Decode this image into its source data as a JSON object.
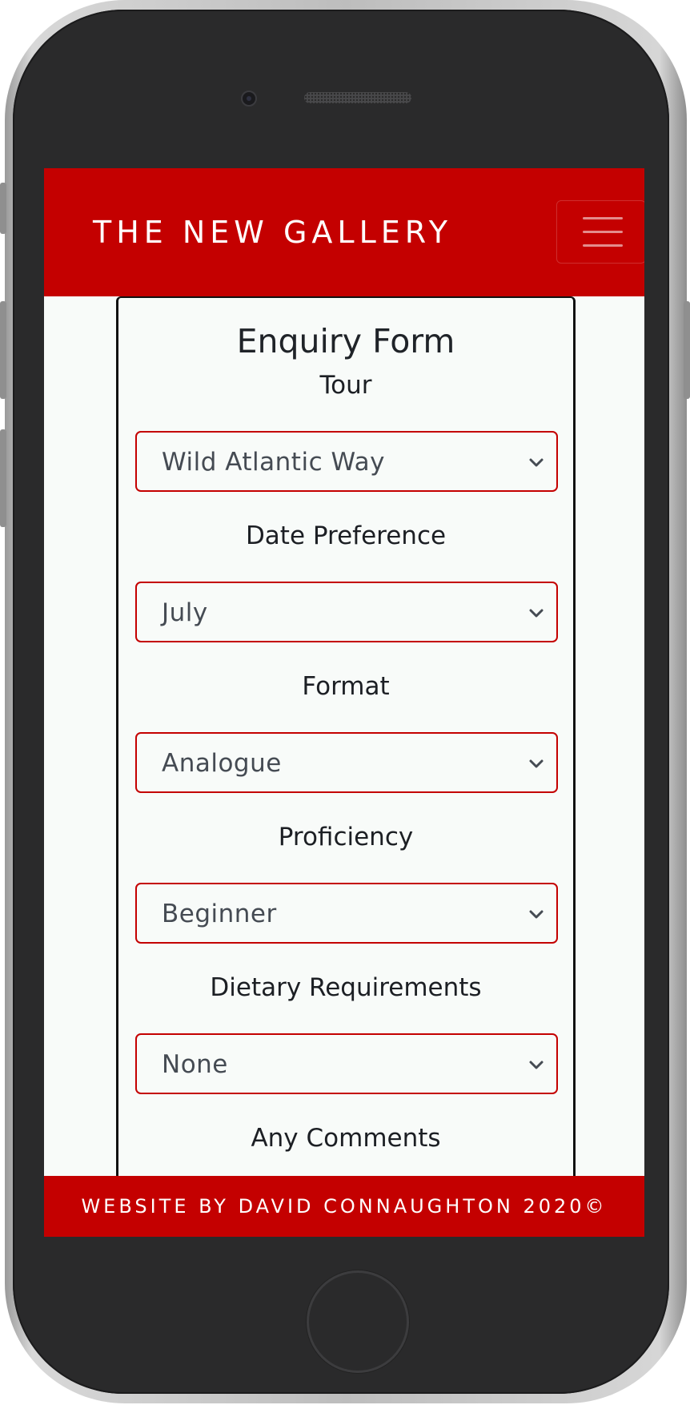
{
  "brand": "THE NEW GALLERY",
  "form": {
    "title": "Enquiry Form",
    "fields": [
      {
        "label": "Tour",
        "value": "Wild Atlantic Way"
      },
      {
        "label": "Date Preference",
        "value": "July"
      },
      {
        "label": "Format",
        "value": "Analogue"
      },
      {
        "label": "Proficiency",
        "value": "Beginner"
      },
      {
        "label": "Dietary Requirements",
        "value": "None"
      },
      {
        "label": "Any Comments"
      }
    ]
  },
  "footer": {
    "text": "WEBSITE BY DAVID CONNAUGHTON 2020©"
  },
  "colors": {
    "accent": "#c40000",
    "background": "#f8fbf9",
    "text": "#1c1f24"
  },
  "icons": [
    "hamburger-menu-icon",
    "chevron-down-icon"
  ]
}
